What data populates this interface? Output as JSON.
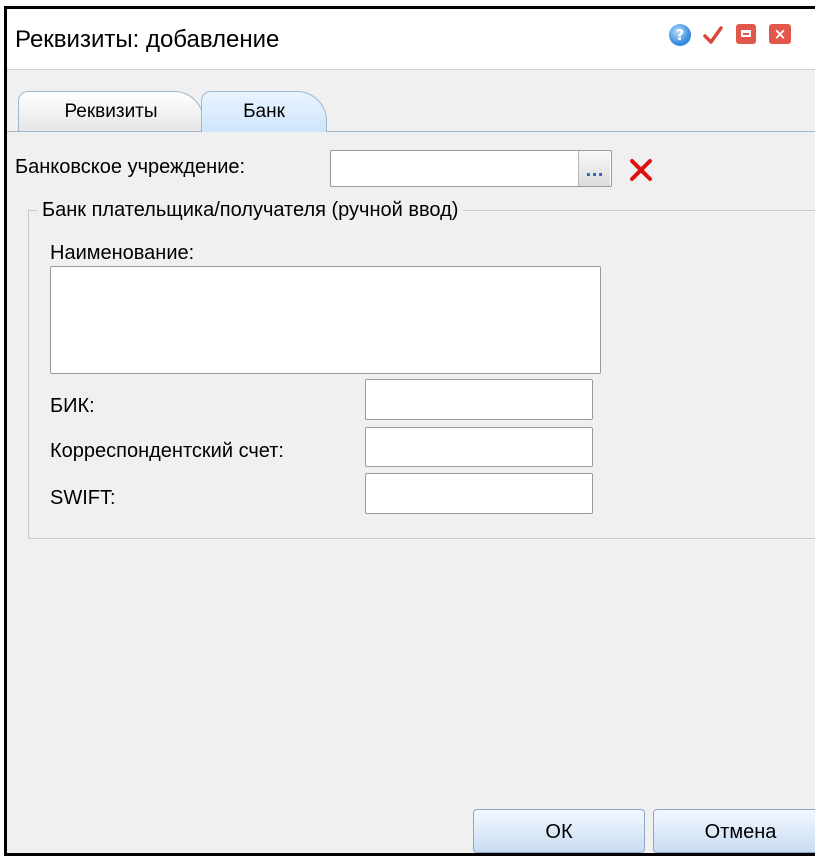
{
  "window": {
    "title": "Реквизиты: добавление",
    "help_icon": "?",
    "close_icon": "×"
  },
  "tabs": [
    {
      "label": "Реквизиты",
      "active": false
    },
    {
      "label": "Банк",
      "active": true
    }
  ],
  "bank_institution": {
    "label": "Банковское учреждение:",
    "value": "",
    "picker_label": "..."
  },
  "manual_group": {
    "legend": "Банк плательщика/получателя (ручной ввод)",
    "name_label": "Наименование:",
    "name_value": "",
    "bik_label": "БИК:",
    "bik_value": "",
    "corr_label": "Корреспондентский счет:",
    "corr_value": "",
    "swift_label": "SWIFT:",
    "swift_value": ""
  },
  "footer": {
    "ok_label": "ОК",
    "cancel_label": "Отмена"
  },
  "colors": {
    "accent_red": "#e2574c",
    "clear_red": "#e01010",
    "tab_active": "#cfe5fb"
  }
}
